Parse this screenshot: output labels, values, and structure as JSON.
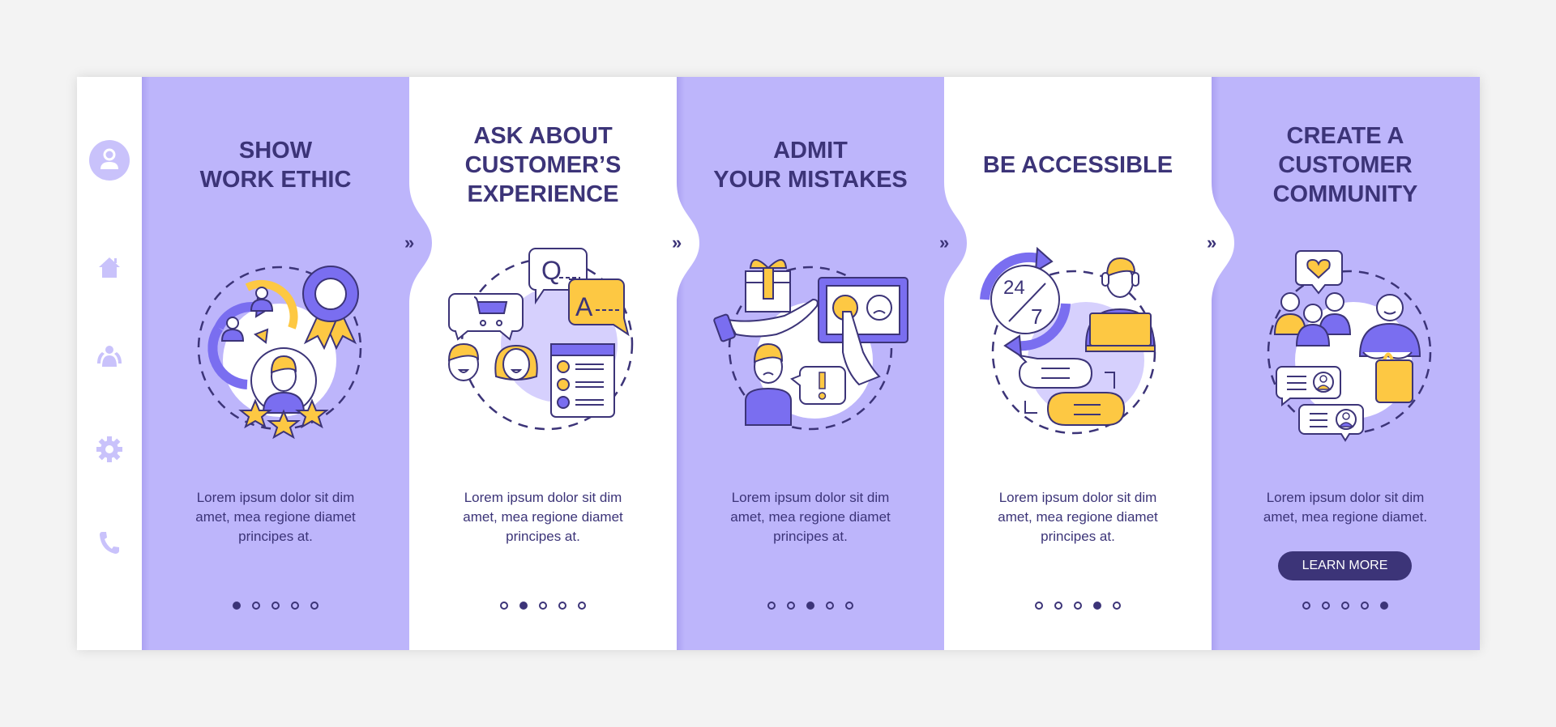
{
  "colors": {
    "accent_purple": "#bdb5fb",
    "dark_text": "#3c3478",
    "yellow": "#fdc843",
    "mid_purple": "#7a6ef0",
    "background": "#f3f3f3"
  },
  "sidebar": {
    "items": [
      {
        "icon": "user-icon"
      },
      {
        "icon": "home-icon"
      },
      {
        "icon": "group-icon"
      },
      {
        "icon": "gear-icon"
      },
      {
        "icon": "phone-icon"
      }
    ]
  },
  "next_arrow": "»",
  "screens": [
    {
      "title": "SHOW\nWORK ETHIC",
      "body": "Lorem ipsum dolor sit dim\namet, mea regione diamet\nprincipes at.",
      "illustration": "work-ethic-illustration",
      "page_index": 1,
      "page_count": 5
    },
    {
      "title": "ASK ABOUT\nCUSTOMER’S\nEXPERIENCE",
      "body": "Lorem ipsum dolor sit dim\namet, mea regione diamet\nprincipes at.",
      "illustration": "customer-experience-illustration",
      "page_index": 2,
      "page_count": 5
    },
    {
      "title": "ADMIT\nYOUR MISTAKES",
      "body": "Lorem ipsum dolor sit dim\namet, mea regione diamet\nprincipes at.",
      "illustration": "admit-mistakes-illustration",
      "page_index": 3,
      "page_count": 5
    },
    {
      "title": "BE ACCESSIBLE",
      "body": "Lorem ipsum dolor sit dim\namet, mea regione diamet\nprincipes at.",
      "illustration": "accessible-support-illustration",
      "page_index": 4,
      "page_count": 5
    },
    {
      "title": "CREATE A\nCUSTOMER\nCOMMUNITY",
      "body": "Lorem ipsum dolor sit dim\namet, mea regione diamet.",
      "illustration": "customer-community-illustration",
      "button_label": "LEARN MORE",
      "page_index": 5,
      "page_count": 5
    }
  ]
}
